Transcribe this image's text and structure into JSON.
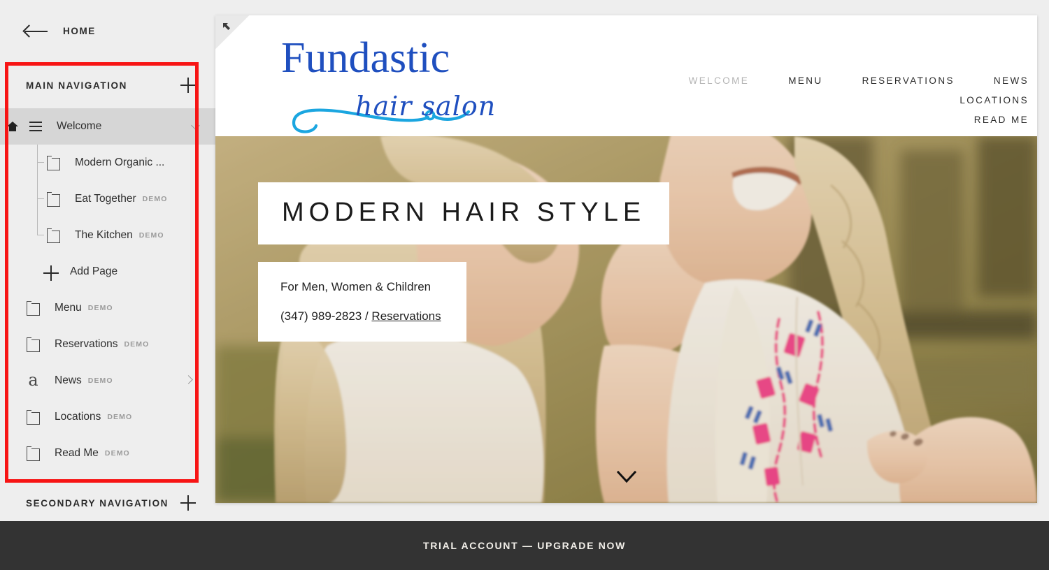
{
  "sidebar": {
    "back_label": "HOME",
    "back_icon": "arrow-left-icon",
    "main_nav": {
      "title": "MAIN NAVIGATION",
      "add_icon": "plus-icon"
    },
    "secondary_nav": {
      "title": "SECONDARY NAVIGATION",
      "add_icon": "plus-icon"
    },
    "items": [
      {
        "label": "Welcome",
        "demo": "",
        "icon": "list-icon",
        "home": true,
        "active": true,
        "chevron": "down",
        "indent": 0
      },
      {
        "label": "Modern Organic ...",
        "demo": "",
        "icon": "page-icon",
        "home": false,
        "active": false,
        "chevron": "",
        "indent": 1
      },
      {
        "label": "Eat Together",
        "demo": "DEMO",
        "icon": "page-icon",
        "home": false,
        "active": false,
        "chevron": "",
        "indent": 1
      },
      {
        "label": "The Kitchen",
        "demo": "DEMO",
        "icon": "page-icon",
        "home": false,
        "active": false,
        "chevron": "",
        "indent": 1
      },
      {
        "label": "Add Page",
        "demo": "",
        "icon": "plus-icon",
        "home": false,
        "active": false,
        "chevron": "",
        "indent": 1
      },
      {
        "label": "Menu",
        "demo": "DEMO",
        "icon": "page-icon",
        "home": false,
        "active": false,
        "chevron": "",
        "indent": 0
      },
      {
        "label": "Reservations",
        "demo": "DEMO",
        "icon": "page-icon",
        "home": false,
        "active": false,
        "chevron": "",
        "indent": 0
      },
      {
        "label": "News",
        "demo": "DEMO",
        "icon": "blog-a-icon",
        "home": false,
        "active": false,
        "chevron": "right",
        "indent": 0
      },
      {
        "label": "Locations",
        "demo": "DEMO",
        "icon": "page-icon",
        "home": false,
        "active": false,
        "chevron": "",
        "indent": 0
      },
      {
        "label": "Read Me",
        "demo": "DEMO",
        "icon": "page-icon",
        "home": false,
        "active": false,
        "chevron": "",
        "indent": 0
      }
    ]
  },
  "annotation": {
    "color": "#f71414",
    "target": "main-navigation-panel"
  },
  "preview": {
    "resize_handle_icon": "resize-nw-icon",
    "site": {
      "logo": {
        "main": "Fundastic",
        "sub": "hair salon",
        "color": "#1f4fbf",
        "accent": "#1ba6e0"
      },
      "nav": [
        {
          "label": "WELCOME",
          "active": true
        },
        {
          "label": "MENU",
          "active": false
        },
        {
          "label": "RESERVATIONS",
          "active": false
        },
        {
          "label": "NEWS",
          "active": false
        },
        {
          "label": "LOCATIONS",
          "active": false
        },
        {
          "label": "READ ME",
          "active": false
        }
      ],
      "hero": {
        "title": "MODERN HAIR STYLE",
        "subtitle_1": "For Men, Women & Children",
        "phone": "(347) 989-2823 / ",
        "link": "Reservations",
        "scroll_icon": "chevron-down-icon"
      }
    }
  },
  "trial_bar": {
    "text": "TRIAL ACCOUNT — UPGRADE NOW",
    "background": "#333333"
  }
}
